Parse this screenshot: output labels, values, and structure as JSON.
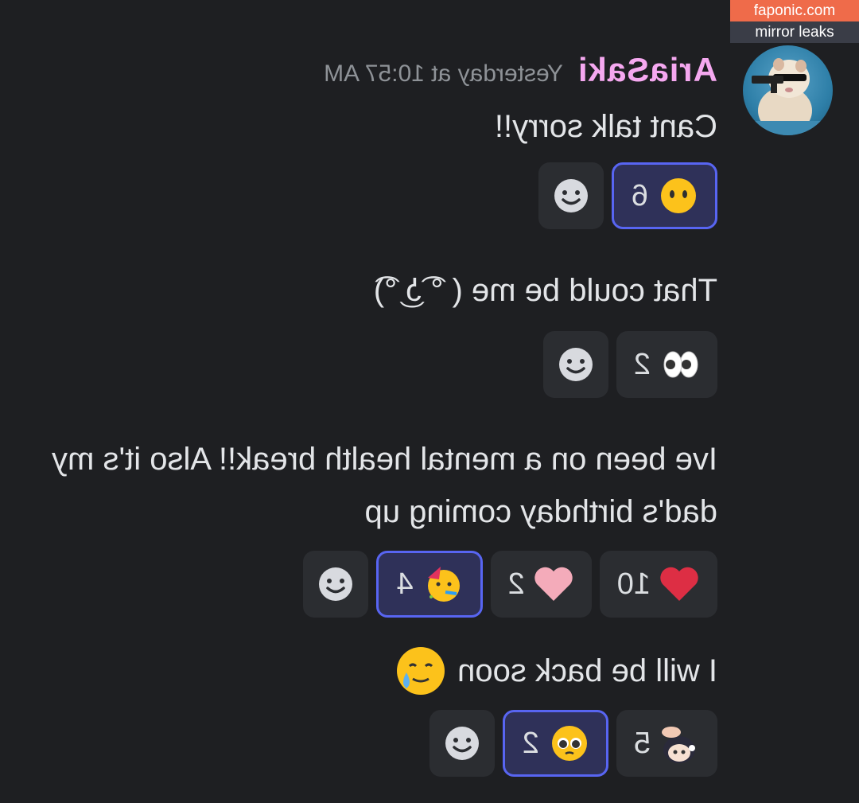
{
  "watermark": {
    "site": "faponic.com",
    "tag": "mirror leaks"
  },
  "author": {
    "name": "AriaSaki",
    "timestamp": "Yesterday at 10:57 AM"
  },
  "messages": [
    {
      "text": "Cant talk sorry!!",
      "reactions": [
        {
          "emoji": "no-mouth-face",
          "count": "6",
          "me": true
        }
      ]
    },
    {
      "text": "That could be me ( ͡° ͜ʖ ͡°)",
      "reactions": [
        {
          "emoji": "eyes",
          "count": "2",
          "me": false
        }
      ]
    },
    {
      "text": "Ive been on a mental health break!! Also it's my dad's birthday coming up",
      "reactions": [
        {
          "emoji": "red-heart",
          "count": "10",
          "me": false
        },
        {
          "emoji": "pink-heart",
          "count": "2",
          "me": false
        },
        {
          "emoji": "partying-face",
          "count": "4",
          "me": true
        }
      ]
    },
    {
      "text": "I will be back soon",
      "inline_emoji": "smiling-face-with-tear",
      "reactions": [
        {
          "emoji": "custom-anime-headpat",
          "count": "5",
          "me": false
        },
        {
          "emoji": "pleading-face",
          "count": "2",
          "me": true
        }
      ]
    }
  ],
  "icons": {
    "add_reaction": "add-reaction-smiley-icon"
  },
  "colors": {
    "background": "#1e1f22",
    "username": "#f5a8f0",
    "reaction_active_border": "#5865f2"
  }
}
